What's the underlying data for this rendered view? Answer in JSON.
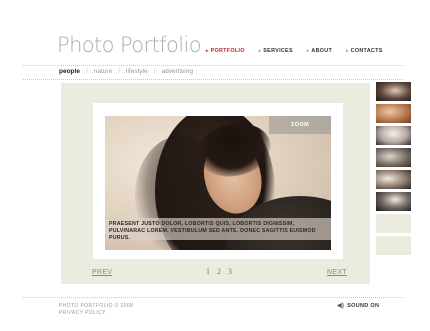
{
  "site": {
    "title": "Photo Portfolio"
  },
  "nav": [
    {
      "label": "PORTFOLIO",
      "active": true
    },
    {
      "label": "SERVICES",
      "active": false
    },
    {
      "label": "ABOUT",
      "active": false
    },
    {
      "label": "CONTACTS",
      "active": false
    }
  ],
  "subnav": [
    "people",
    "nature",
    "lifestyle",
    "advertising"
  ],
  "subnav_separator": "/",
  "photo": {
    "zoom_label": "ZOOM",
    "caption": "PRAESENT JUSTO DOLOR, LOBORTIS QUIS, LOBORTIS DIGNISSIM, PULVINARAC LOREM. VESTIBULUM SED ANTE. DONEC SAGITTIS EUISMOD PURUS."
  },
  "pager": {
    "prev": "PREV",
    "next": "NEXT",
    "pages": [
      "1",
      "2",
      "3"
    ]
  },
  "footer": {
    "copyright": "PHOTO PORTFOLIO © 2008",
    "privacy": "PRIVACY POLICY",
    "sound": "SOUND ON"
  },
  "icons": {
    "nav_arrow": "arrow-right-icon",
    "speaker": "speaker-icon"
  },
  "colors": {
    "accent": "#b3252a",
    "frame": "#ecebdf",
    "title": "#a7acb0"
  }
}
